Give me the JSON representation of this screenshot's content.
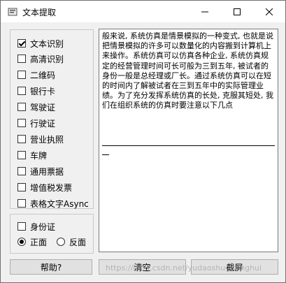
{
  "window": {
    "title": "文本提取"
  },
  "options": [
    {
      "label": "文本识别",
      "checked": true
    },
    {
      "label": "高清识别",
      "checked": false
    },
    {
      "label": "二维码",
      "checked": false
    },
    {
      "label": "银行卡",
      "checked": false
    },
    {
      "label": "驾驶证",
      "checked": false
    },
    {
      "label": "行驶证",
      "checked": false
    },
    {
      "label": "营业执照",
      "checked": false
    },
    {
      "label": "车牌",
      "checked": false
    },
    {
      "label": "通用票据",
      "checked": false
    },
    {
      "label": "增值税发票",
      "checked": false
    },
    {
      "label": "表格文字Async",
      "checked": false
    }
  ],
  "idcard": {
    "label": "身份证",
    "checked": false,
    "front_label": "正面",
    "back_label": "反面",
    "selected": "front"
  },
  "result": {
    "text": "般来说, 系统仿真是情景模拟的一种变式, 也就是说把情景模拟的许多可以数量化的内容搬到计算机上来操作。系统仿真可以仿真各种企业, 系统仿真规定的经营管理时间可长可般为三到五年, 被试者的身份一般是总经理或厂长。通过系统仿真可以在短的时间内了解被试者在三到五年中的实际管理业绩。为了充分发挥系统仿真的长处, 克服其短处, 我们在组织系统的仿真时要注意以下几点"
  },
  "buttons": {
    "help": "帮助?",
    "clear": "清空",
    "screenshot": "截屏"
  },
  "watermark": "https://blog.csdn.net/yudaoshuguanghui"
}
